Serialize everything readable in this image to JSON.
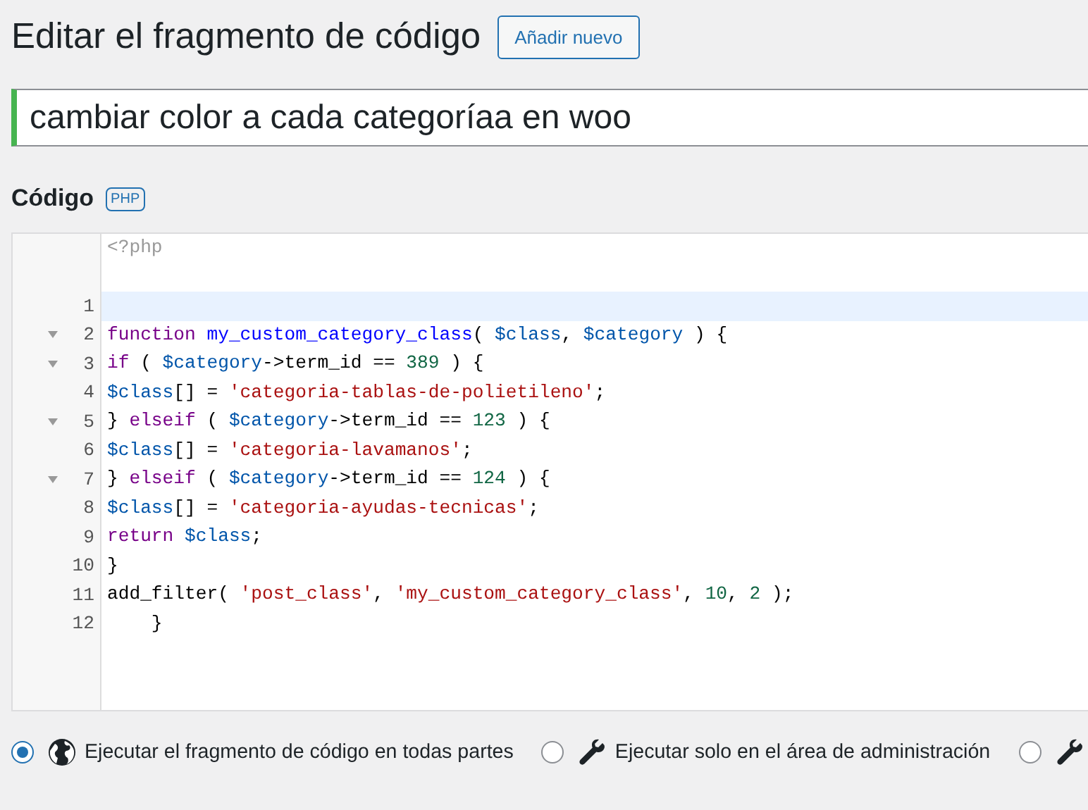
{
  "heading": "Editar el fragmento de código",
  "add_new_button": "Añadir nuevo",
  "snippet_title": {
    "value": "cambiar color a cada categoríaa en woo"
  },
  "code_section": {
    "label": "Código",
    "badge": "PHP"
  },
  "editor": {
    "header": "<?php",
    "lines": [
      {
        "number": "1",
        "foldable": false,
        "active": true
      },
      {
        "number": "2",
        "foldable": true,
        "active": false,
        "tokens": [
          {
            "kind": "keyword",
            "text": "function"
          },
          {
            "kind": "def",
            "text": " my_custom_category_class"
          },
          {
            "kind": "plain",
            "text": "( "
          },
          {
            "kind": "variable",
            "text": "$class"
          },
          {
            "kind": "plain",
            "text": ", "
          },
          {
            "kind": "variable",
            "text": "$category"
          },
          {
            "kind": "plain",
            "text": " ) {"
          }
        ]
      },
      {
        "number": "3",
        "foldable": true,
        "active": false,
        "tokens": [
          {
            "kind": "keyword",
            "text": "if"
          },
          {
            "kind": "plain",
            "text": " ( "
          },
          {
            "kind": "variable",
            "text": "$category"
          },
          {
            "kind": "plain",
            "text": "->term_id == "
          },
          {
            "kind": "number",
            "text": "389"
          },
          {
            "kind": "plain",
            "text": " ) {"
          }
        ]
      },
      {
        "number": "4",
        "foldable": false,
        "active": false,
        "tokens": [
          {
            "kind": "variable",
            "text": "$class"
          },
          {
            "kind": "plain",
            "text": "[] = "
          },
          {
            "kind": "string",
            "text": "'categoria-tablas-de-polietileno'"
          },
          {
            "kind": "plain",
            "text": ";"
          }
        ]
      },
      {
        "number": "5",
        "foldable": true,
        "active": false,
        "tokens": [
          {
            "kind": "plain",
            "text": "} "
          },
          {
            "kind": "keyword",
            "text": "elseif"
          },
          {
            "kind": "plain",
            "text": " ( "
          },
          {
            "kind": "variable",
            "text": "$category"
          },
          {
            "kind": "plain",
            "text": "->term_id == "
          },
          {
            "kind": "number",
            "text": "123"
          },
          {
            "kind": "plain",
            "text": " ) {"
          }
        ]
      },
      {
        "number": "6",
        "foldable": false,
        "active": false,
        "tokens": [
          {
            "kind": "variable",
            "text": "$class"
          },
          {
            "kind": "plain",
            "text": "[] = "
          },
          {
            "kind": "string",
            "text": "'categoria-lavamanos'"
          },
          {
            "kind": "plain",
            "text": ";"
          }
        ]
      },
      {
        "number": "7",
        "foldable": true,
        "active": false,
        "tokens": [
          {
            "kind": "plain",
            "text": "} "
          },
          {
            "kind": "keyword",
            "text": "elseif"
          },
          {
            "kind": "plain",
            "text": " ( "
          },
          {
            "kind": "variable",
            "text": "$category"
          },
          {
            "kind": "plain",
            "text": "->term_id == "
          },
          {
            "kind": "number",
            "text": "124"
          },
          {
            "kind": "plain",
            "text": " ) {"
          }
        ]
      },
      {
        "number": "8",
        "foldable": false,
        "active": false,
        "tokens": [
          {
            "kind": "variable",
            "text": "$class"
          },
          {
            "kind": "plain",
            "text": "[] = "
          },
          {
            "kind": "string",
            "text": "'categoria-ayudas-tecnicas'"
          },
          {
            "kind": "plain",
            "text": ";"
          }
        ]
      },
      {
        "number": "9",
        "foldable": false,
        "active": false,
        "tokens": [
          {
            "kind": "keyword",
            "text": "return"
          },
          {
            "kind": "variable",
            "text": " $class"
          },
          {
            "kind": "plain",
            "text": ";"
          }
        ]
      },
      {
        "number": "10",
        "foldable": false,
        "active": false,
        "tokens": [
          {
            "kind": "plain",
            "text": "}"
          }
        ]
      },
      {
        "number": "11",
        "foldable": false,
        "active": false,
        "tokens": [
          {
            "kind": "plain",
            "text": "add_filter( "
          },
          {
            "kind": "string",
            "text": "'post_class'"
          },
          {
            "kind": "plain",
            "text": ", "
          },
          {
            "kind": "string",
            "text": "'my_custom_category_class'"
          },
          {
            "kind": "plain",
            "text": ", "
          },
          {
            "kind": "number",
            "text": "10"
          },
          {
            "kind": "plain",
            "text": ", "
          },
          {
            "kind": "number",
            "text": "2"
          },
          {
            "kind": "plain",
            "text": " );"
          }
        ]
      },
      {
        "number": "12",
        "foldable": false,
        "active": false,
        "tokens": [
          {
            "kind": "plain",
            "text": "    }"
          }
        ]
      }
    ]
  },
  "scope_options": [
    {
      "label": "Ejecutar el fragmento de código en todas partes",
      "selected": true
    },
    {
      "label": "Ejecutar solo en el área de administración",
      "selected": false
    },
    {
      "selected": false
    }
  ]
}
